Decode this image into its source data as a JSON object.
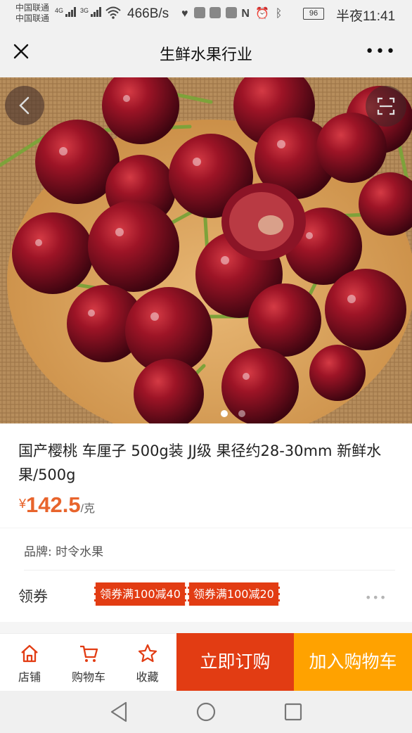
{
  "status_bar": {
    "carrier_1": "中国联通",
    "carrier_2": "中国联通",
    "sig1": "4G",
    "sig2": "3G",
    "net_speed": "466B/s",
    "battery": "96",
    "time": "半夜11:41",
    "icons": [
      "heart-rate-icon",
      "app-icon",
      "app-icon",
      "app-icon",
      "nfc-icon",
      "alarm-icon",
      "bluetooth-icon"
    ]
  },
  "header": {
    "title": "生鲜水果行业",
    "more": "•••"
  },
  "gallery": {
    "page_count": 2,
    "active_index": 0
  },
  "product": {
    "title": "国产樱桃 车厘子 500g装 JJ级 果径约28-30mm 新鲜水果/500g",
    "price_symbol": "¥",
    "price": "142.5",
    "price_unit": "/克",
    "brand": "品牌: 时令水果",
    "coupon_label": "领券",
    "coupons": [
      "领券满100减40",
      "领券满100减20"
    ],
    "coupon_more": "•••"
  },
  "action_bar": {
    "shop": "店铺",
    "cart": "购物车",
    "favorite": "收藏",
    "buy_now": "立即订购",
    "add_to_cart": "加入购物车"
  },
  "colors": {
    "accent": "#e23c13",
    "price": "#e8642c",
    "cart_button": "#ffa200"
  }
}
